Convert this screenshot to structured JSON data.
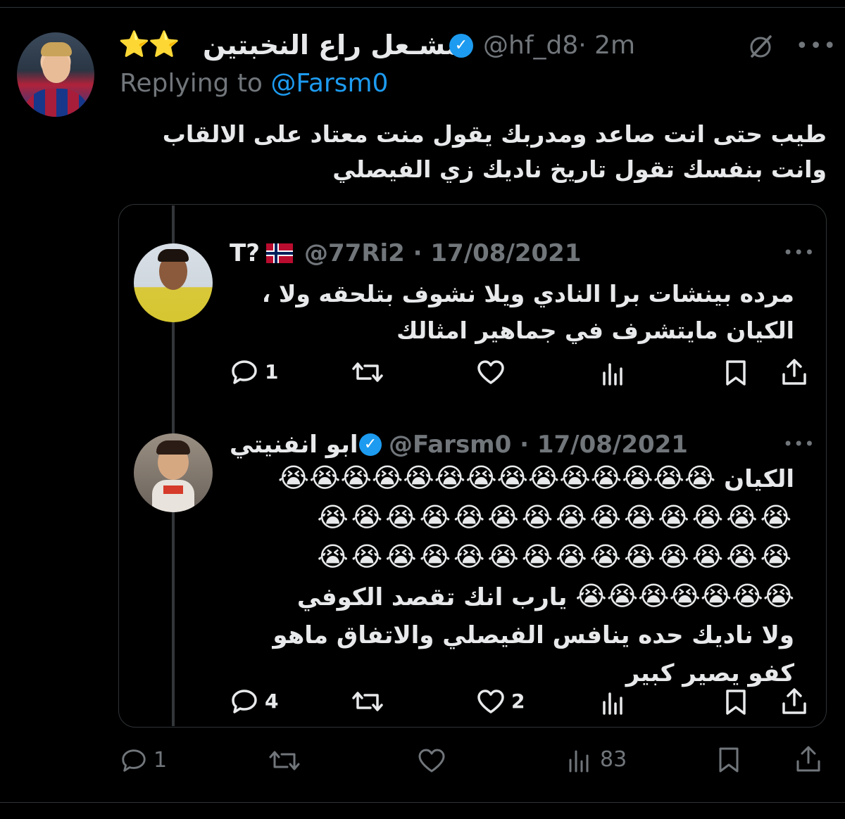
{
  "tweet": {
    "display_name": "مشـعل راع النخبتين",
    "stars": "⭐⭐",
    "handle": "@hf_d8",
    "time": "· 2m",
    "replying_prefix": "Replying to",
    "replying_to": "@Farsm0",
    "text": "طيب حتى انت صاعد ومدربك يقول منت معتاد على الالقاب وانت بنفسك تقول تاريخ ناديك زي الفيصلي",
    "reply_count": "1",
    "retweet_count": "",
    "like_count": "",
    "views_count": "83"
  },
  "quoted": [
    {
      "display_name": "T?",
      "handle_time": "@77Ri2 · 17/08/2021",
      "text": "مرده بينشات برا النادي ويلا نشوف بتلحقه ولا ، الكيان مايتشرف في جماهير امثالك",
      "reply_count": "1",
      "like_count": ""
    },
    {
      "display_name": "ابو انفنيتي",
      "handle_time": "@Farsm0 · 17/08/2021",
      "text_start": "الكيان",
      "emoji_line1": "😭😭😭😭😭😭😭😭😭😭😭😭😭😭",
      "emoji_line2": "😭😭😭😭😭😭😭😭😭😭😭😭😭😭",
      "emoji_line3": "😭😭😭😭😭😭😭😭😭😭😭😭😭😭",
      "emoji_line4": "😭😭😭😭😭😭😭",
      "text_mid": "يارب انك تقصد الكوفي",
      "text_end1": "ولا ناديك حده ينافس الفيصلي والاتفاق ماهو",
      "text_end2": "كفو يصير كبير",
      "reply_count": "4",
      "like_count": "2"
    }
  ],
  "colors": {
    "background": "#000000",
    "text": "#e7e9ea",
    "muted": "#71767b",
    "accent": "#1d9bf0",
    "star": "#f5c518"
  },
  "icons": [
    "reply-icon",
    "retweet-icon",
    "like-icon",
    "views-icon",
    "bookmark-icon",
    "share-icon",
    "grok-icon",
    "more-icon",
    "verified-icon"
  ]
}
